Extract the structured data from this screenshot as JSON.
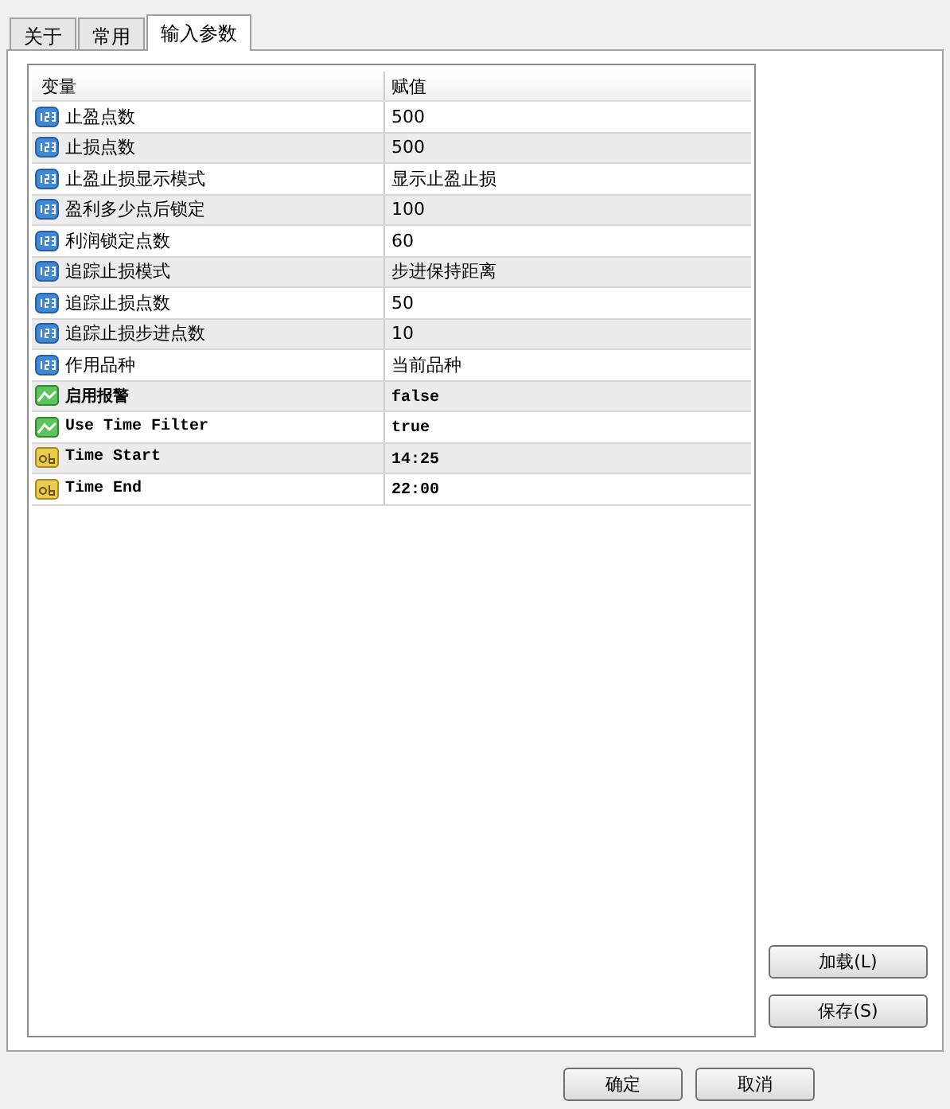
{
  "tabs": [
    {
      "label": "关于",
      "selected": false
    },
    {
      "label": "常用",
      "selected": false
    },
    {
      "label": "输入参数",
      "selected": true
    }
  ],
  "table": {
    "columns": [
      "变量",
      "赋值"
    ],
    "rows": [
      {
        "kind": "number",
        "name": "止盈点数",
        "value": "500"
      },
      {
        "kind": "number",
        "name": "止损点数",
        "value": "500"
      },
      {
        "kind": "number",
        "name": "止盈止损显示模式",
        "value": "显示止盈止损"
      },
      {
        "kind": "number",
        "name": "盈利多少点后锁定",
        "value": "100"
      },
      {
        "kind": "number",
        "name": "利润锁定点数",
        "value": "60"
      },
      {
        "kind": "number",
        "name": "追踪止损模式",
        "value": "步进保持距离"
      },
      {
        "kind": "number",
        "name": "追踪止损点数",
        "value": "50"
      },
      {
        "kind": "number",
        "name": "追踪止损步进点数",
        "value": "10"
      },
      {
        "kind": "number",
        "name": "作用品种",
        "value": "当前品种"
      },
      {
        "kind": "bool",
        "name": "启用报警",
        "value": "false"
      },
      {
        "kind": "bool",
        "name": "Use Time Filter",
        "value": "true"
      },
      {
        "kind": "string",
        "name": "Time Start",
        "value": "14:25"
      },
      {
        "kind": "string",
        "name": "Time End",
        "value": "22:00"
      }
    ]
  },
  "side_buttons": [
    "加载(L)",
    "保存(S)"
  ],
  "buttons": [
    "确定",
    "取消"
  ]
}
